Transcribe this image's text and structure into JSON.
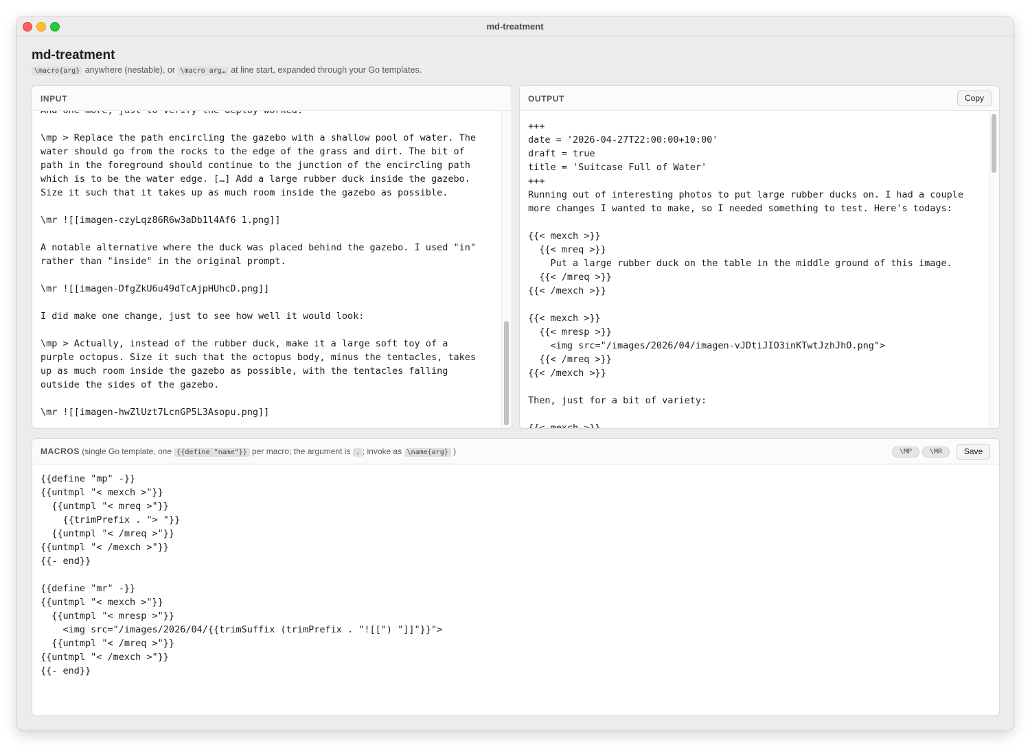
{
  "window": {
    "title": "md-treatment"
  },
  "header": {
    "title": "md-treatment",
    "subtitle": {
      "code1": "\\macro{arg}",
      "text1": " anywhere (nestable), or ",
      "code2": "\\macro arg…",
      "text2": " at line start, expanded through your Go templates."
    }
  },
  "input": {
    "label": "INPUT",
    "text": "And one more, just to verify the deploy worked.\n\n\\mp > Replace the path encircling the gazebo with a shallow pool of water. The\nwater should go from the rocks to the edge of the grass and dirt. The bit of\npath in the foreground should continue to the junction of the encircling path\nwhich is to be the water edge. […] Add a large rubber duck inside the gazebo.\nSize it such that it takes up as much room inside the gazebo as possible.\n\n\\mr ![[imagen-czyLqz86R6w3aDb1l4Af6 1.png]]\n\nA notable alternative where the duck was placed behind the gazebo. I used \"in\"\nrather than \"inside\" in the original prompt.\n\n\\mr ![[imagen-DfgZkU6u49dTcAjpHUhcD.png]]\n\nI did make one change, just to see how well it would look:\n\n\\mp > Actually, instead of the rubber duck, make it a large soft toy of a\npurple octopus. Size it such that the octopus body, minus the tentacles, takes\nup as much room inside the gazebo as possible, with the tentacles falling\noutside the sides of the gazebo.\n\n\\mr ![[imagen-hwZlUzt7LcnGP5L3Asopu.png]]"
  },
  "output": {
    "label": "OUTPUT",
    "copy_label": "Copy",
    "text": "+++\ndate = '2026-04-27T22:00:00+10:00'\ndraft = true\ntitle = 'Suitcase Full of Water'\n+++\nRunning out of interesting photos to put large rubber ducks on. I had a couple\nmore changes I wanted to make, so I needed something to test. Here's todays:\n\n{{< mexch >}}\n  {{< mreq >}}\n    Put a large rubber duck on the table in the middle ground of this image.\n  {{< /mreq >}}\n{{< /mexch >}}\n\n{{< mexch >}}\n  {{< mresp >}}\n    <img src=\"/images/2026/04/imagen-vJDtiJIO3inKTwtJzhJhO.png\">\n  {{< /mreq >}}\n{{< /mexch >}}\n\nThen, just for a bit of variety:\n\n{{< mexch >}}"
  },
  "macros": {
    "label": "MACROS",
    "desc1": " (single Go template, one ",
    "code1": "{{define \"name\"}}",
    "desc2": " per macro; the argument is ",
    "code2": ".",
    "desc3": "; invoke as ",
    "code3": "\\name{arg}",
    "desc4": " )",
    "chips": [
      "\\MP",
      "\\MR"
    ],
    "save_label": "Save",
    "text": "{{define \"mp\" -}}\n{{untmpl \"< mexch >\"}}\n  {{untmpl \"< mreq >\"}}\n    {{trimPrefix . \"> \"}}\n  {{untmpl \"< /mreq >\"}}\n{{untmpl \"< /mexch >\"}}\n{{- end}}\n\n{{define \"mr\" -}}\n{{untmpl \"< mexch >\"}}\n  {{untmpl \"< mresp >\"}}\n    <img src=\"/images/2026/04/{{trimSuffix (trimPrefix . \"![[\") \"]]\"}}\">\n  {{untmpl \"< /mreq >\"}}\n{{untmpl \"< /mexch >\"}}\n{{- end}}"
  }
}
